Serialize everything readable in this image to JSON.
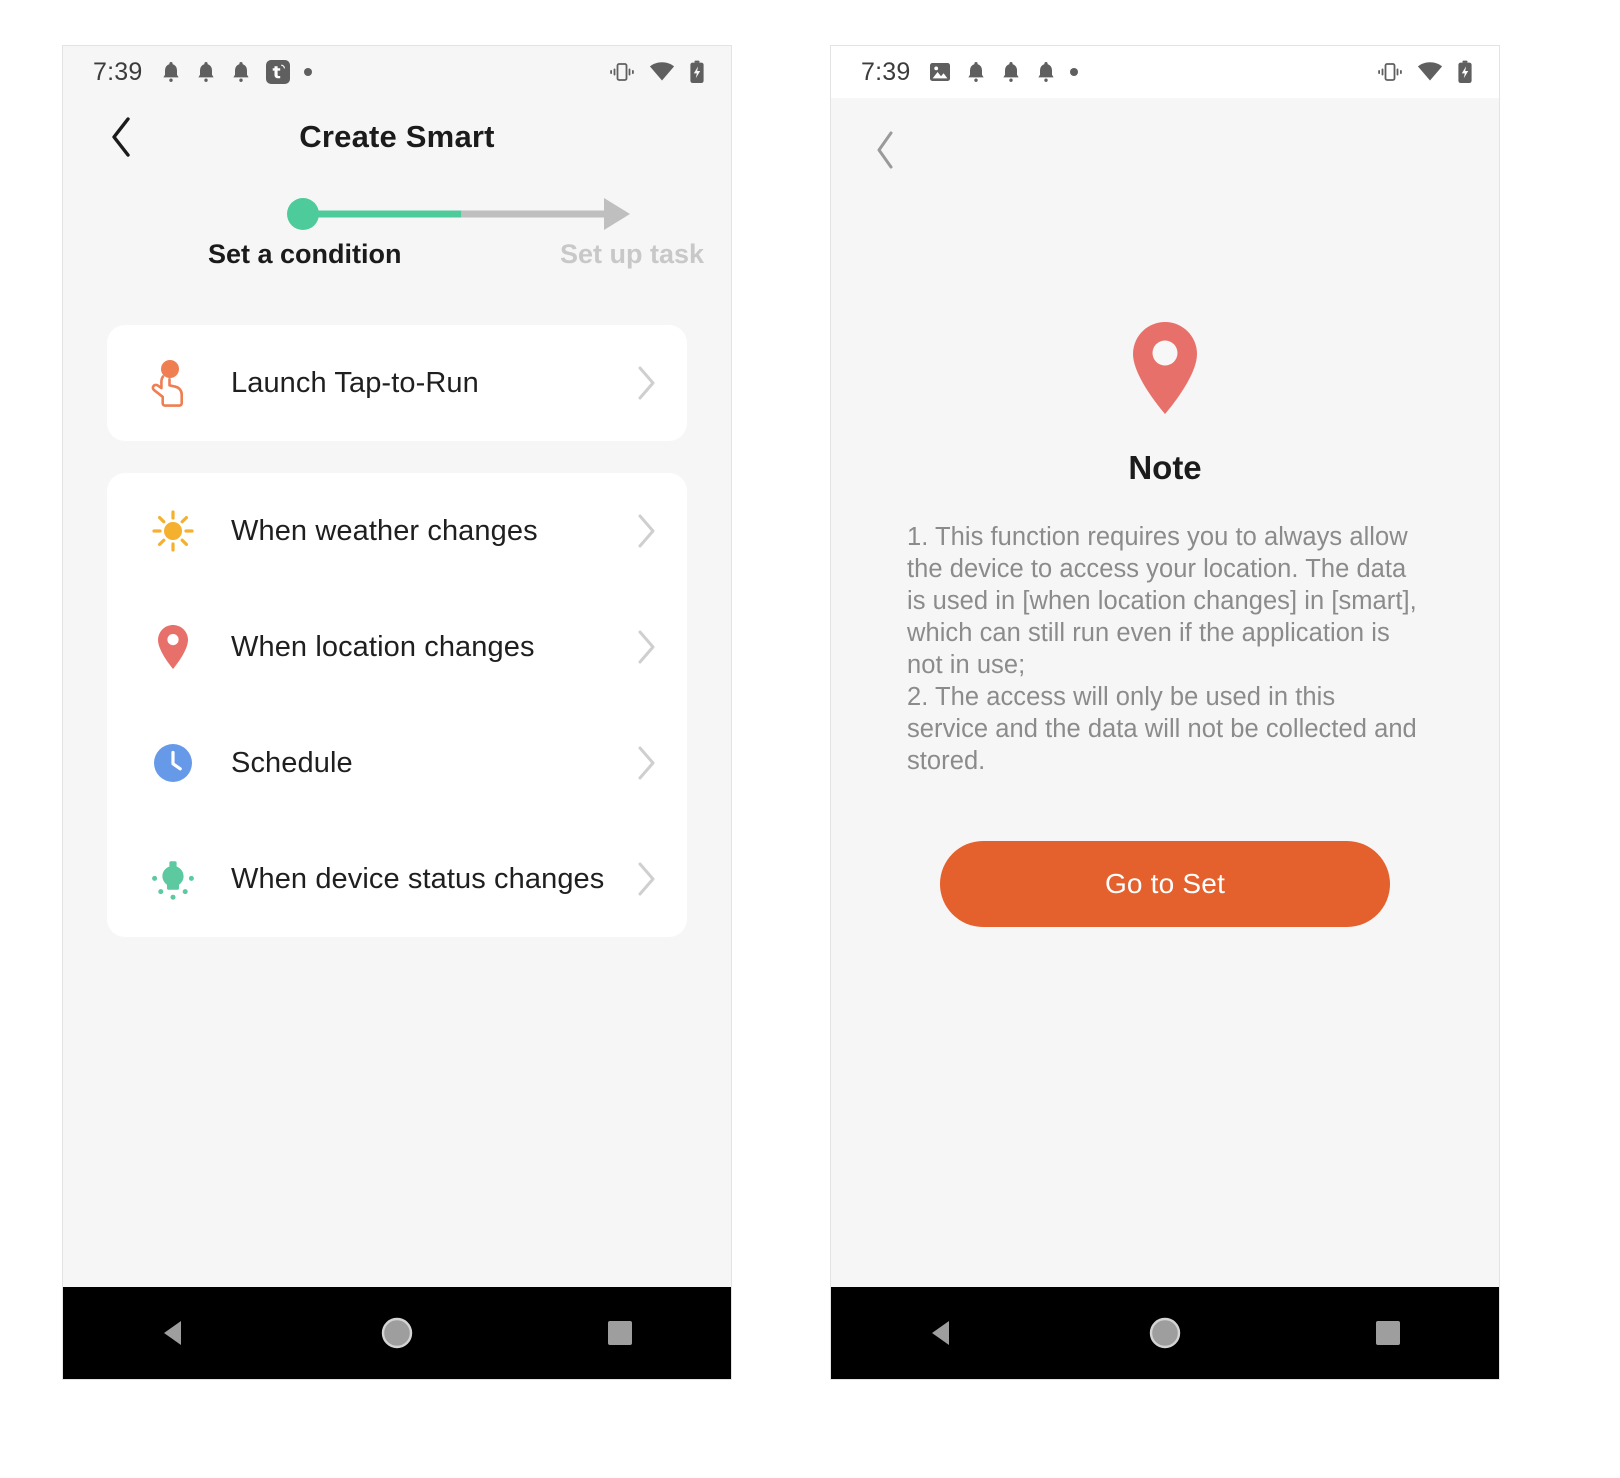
{
  "screens": {
    "left": {
      "status": {
        "time": "7:39",
        "left_icons": [
          "bell-icon",
          "bell-icon",
          "bell-icon",
          "tuya-app-icon",
          "dot-icon"
        ],
        "right_icons": [
          "vibrate-icon",
          "wifi-icon",
          "battery-charging-icon"
        ]
      },
      "appbar": {
        "back": "back-chevron-icon",
        "title": "Create Smart"
      },
      "stepper": {
        "active_label": "Set a condition",
        "inactive_label": "Set up task",
        "progress_percent": 50,
        "active_color": "#4ECB9A",
        "inactive_color": "#BFBFBF"
      },
      "cards": [
        {
          "rows": [
            {
              "icon": "tap-to-run-icon",
              "icon_color": "#EF7E52",
              "label": "Launch Tap-to-Run"
            }
          ]
        },
        {
          "rows": [
            {
              "icon": "sun-icon",
              "icon_color": "#F5B02E",
              "label": "When weather changes"
            },
            {
              "icon": "location-pin-icon",
              "icon_color": "#E8706A",
              "label": "When location changes"
            },
            {
              "icon": "clock-icon",
              "icon_color": "#6699E8",
              "label": "Schedule"
            },
            {
              "icon": "light-bulb-icon",
              "icon_color": "#5CC9A0",
              "label": "When device status changes"
            }
          ]
        }
      ],
      "navbar": [
        "back-triangle-icon",
        "home-circle-icon",
        "recents-square-icon"
      ]
    },
    "right": {
      "status": {
        "time": "7:39",
        "left_icons": [
          "screenshot-icon",
          "bell-icon",
          "bell-icon",
          "bell-icon",
          "dot-icon"
        ],
        "right_icons": [
          "vibrate-icon",
          "wifi-icon",
          "battery-charging-icon"
        ]
      },
      "appbar": {
        "back": "back-chevron-icon",
        "title": ""
      },
      "note": {
        "pin_icon": "location-pin-large-icon",
        "pin_color": "#E8706A",
        "title": "Note",
        "body": "1. This function requires you to always allow the device to access your location. The data is used in [when location changes] in [smart], which can still run even if the application is not in use;\n 2. The access will only be used in this service and the data will not be collected and stored.",
        "button_label": "Go to Set",
        "button_color": "#E4602D"
      },
      "navbar": [
        "back-triangle-icon",
        "home-circle-icon",
        "recents-square-icon"
      ]
    }
  }
}
